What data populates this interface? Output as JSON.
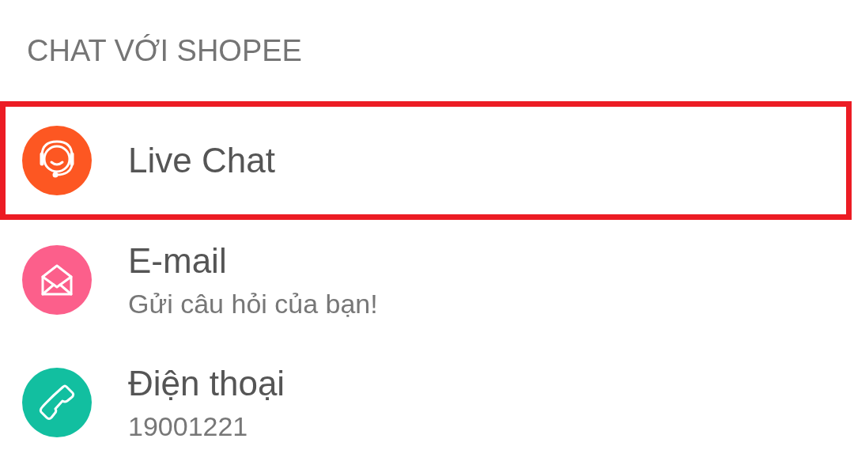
{
  "section_title": "CHAT VỚI SHOPEE",
  "items": [
    {
      "kind": "support",
      "title": "Live Chat",
      "color": "#fd5722",
      "selected": true
    },
    {
      "kind": "email",
      "title": "E-mail",
      "subtitle": "Gửi câu hỏi của bạn!",
      "color": "#fc5f8b",
      "selected": false
    },
    {
      "kind": "phone",
      "title": "Điện thoại",
      "subtitle": "19001221",
      "color": "#12bfa0",
      "selected": false
    }
  ]
}
